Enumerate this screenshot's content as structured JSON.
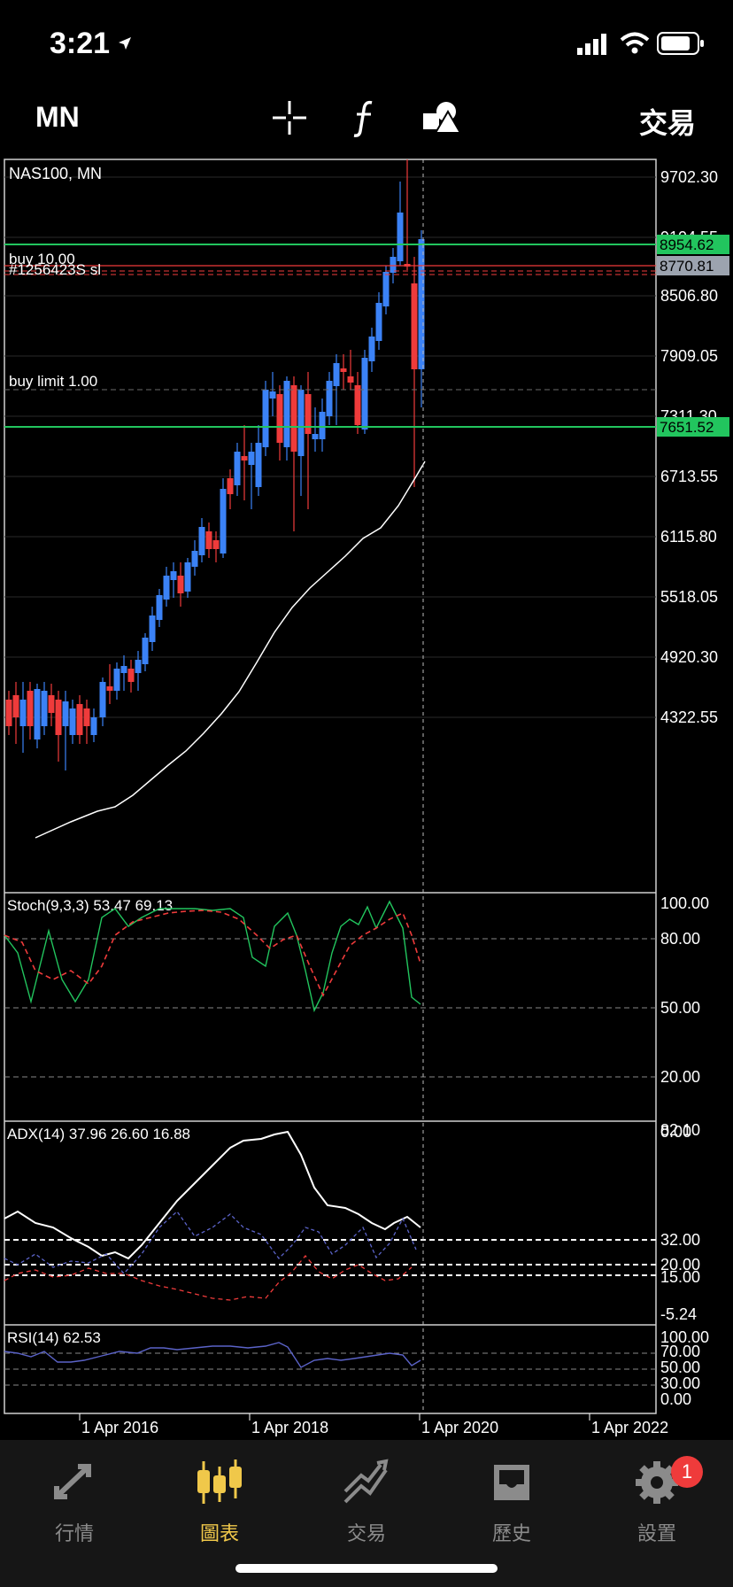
{
  "status_bar": {
    "time": "3:21"
  },
  "toolbar": {
    "timeframe": "MN",
    "trade_label": "交易"
  },
  "chart": {
    "symbol_label": "NAS100, MN",
    "price_labels": [
      "9702.30",
      "9104.55",
      "8506.80",
      "7909.05",
      "7311.30",
      "6713.55",
      "6115.80",
      "5518.05",
      "4920.30",
      "4322.55"
    ],
    "highlight_labels": [
      {
        "text": "8954.62",
        "color": "#22c55e"
      },
      {
        "text": "8770.81",
        "color": "#9ca3af"
      },
      {
        "text": "7651.52",
        "color": "#22c55e"
      }
    ],
    "order_label_top": "buy 10.00",
    "order_label_sub": "#1256423S sl",
    "order_label_limit": "buy limit 1.00",
    "x_labels": [
      "1 Apr 2016",
      "1 Apr 2018",
      "1 Apr 2020",
      "1 Apr 2022"
    ]
  },
  "indicators": {
    "stoch": {
      "label": "Stoch(9,3,3) 53.47 69.13",
      "levels": [
        "100.00",
        "80.00",
        "50.00",
        "20.00",
        "0.00"
      ]
    },
    "adx": {
      "label": "ADX(14) 37.96 26.60 16.88",
      "levels": [
        "82.10",
        "32.00",
        "20.00",
        "15.00",
        "-5.24"
      ]
    },
    "rsi": {
      "label": "RSI(14) 62.53",
      "levels": [
        "100.00",
        "70.00",
        "50.00",
        "30.00",
        "0.00"
      ]
    }
  },
  "tabs": [
    {
      "label": "行情",
      "icon": "quotes-icon",
      "active": false
    },
    {
      "label": "圖表",
      "icon": "chart-candles-icon",
      "active": true
    },
    {
      "label": "交易",
      "icon": "trade-icon",
      "active": false
    },
    {
      "label": "歷史",
      "icon": "history-inbox-icon",
      "active": false
    },
    {
      "label": "設置",
      "icon": "settings-gear-icon",
      "active": false,
      "badge": "1"
    }
  ],
  "colors": {
    "up": "#3b82f6",
    "down": "#ef3b3b",
    "positive_line": "#22c55e",
    "accent_tab": "#f0c84a"
  }
}
